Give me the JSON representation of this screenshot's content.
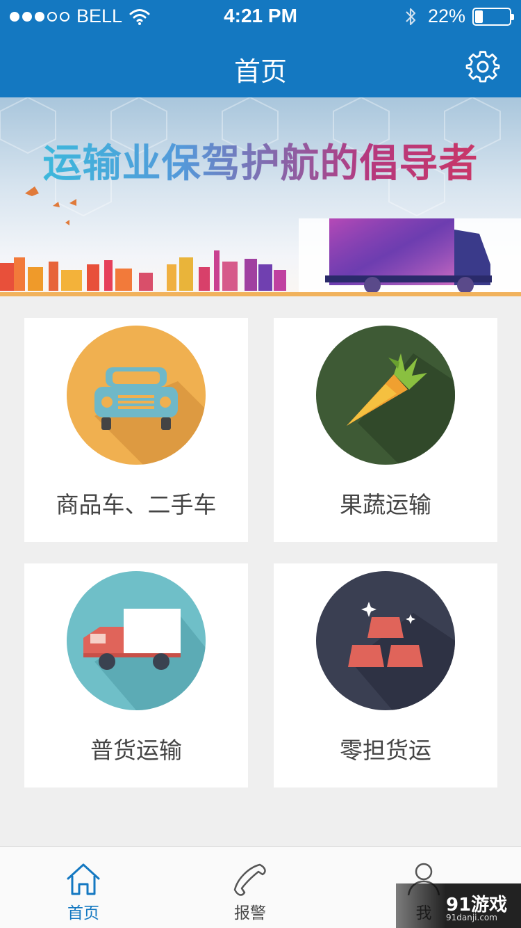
{
  "status_bar": {
    "carrier": "BELL",
    "time": "4:21 PM",
    "battery_percent_text": "22%",
    "battery_level": 0.22,
    "signal_bars_filled": 3,
    "signal_bars_total": 5
  },
  "nav": {
    "title": "首页",
    "settings_icon": "gear-icon"
  },
  "banner": {
    "title": "运输业保驾护航的倡导者"
  },
  "services": [
    {
      "label": "商品车、二手车",
      "icon": "car-icon",
      "color": "#f0b050"
    },
    {
      "label": "果蔬运输",
      "icon": "carrot-icon",
      "color": "#3e5a35"
    },
    {
      "label": "普货运输",
      "icon": "truck-icon",
      "color": "#6fbfc8"
    },
    {
      "label": "零担货运",
      "icon": "gold-bars-icon",
      "color": "#3a3f52"
    }
  ],
  "tabbar": {
    "items": [
      {
        "label": "首页",
        "icon": "home-icon",
        "active": true
      },
      {
        "label": "报警",
        "icon": "phone-icon",
        "active": false
      },
      {
        "label": "我",
        "icon": "user-icon",
        "active": false
      }
    ]
  },
  "watermark": {
    "text": "91游戏",
    "sub": "91danji.com"
  },
  "colors": {
    "primary": "#1478c1",
    "background": "#efefef"
  }
}
